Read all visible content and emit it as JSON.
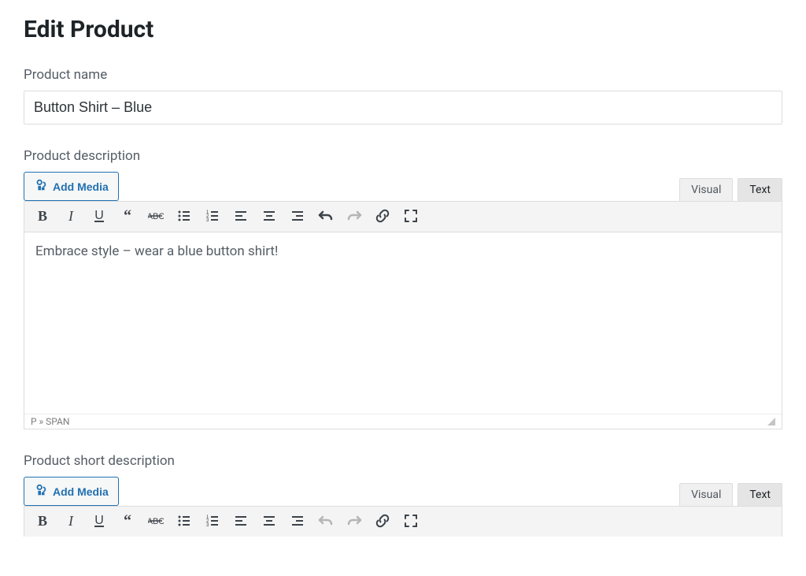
{
  "page_title": "Edit Product",
  "labels": {
    "product_name": "Product name",
    "product_description": "Product description",
    "product_short_description": "Product short description"
  },
  "values": {
    "product_name": "Button Shirt – Blue",
    "description_text": "Embrace style – wear a blue button shirt!",
    "short_description_text": ""
  },
  "editor": {
    "add_media": "Add Media",
    "tabs": {
      "visual": "Visual",
      "text": "Text"
    },
    "status_path": "P » SPAN",
    "toolbar_icons": [
      "bold",
      "italic",
      "underline",
      "blockquote",
      "strikethrough",
      "bulleted-list",
      "numbered-list",
      "align-left",
      "align-center",
      "align-right",
      "undo",
      "redo",
      "link",
      "fullscreen"
    ]
  }
}
